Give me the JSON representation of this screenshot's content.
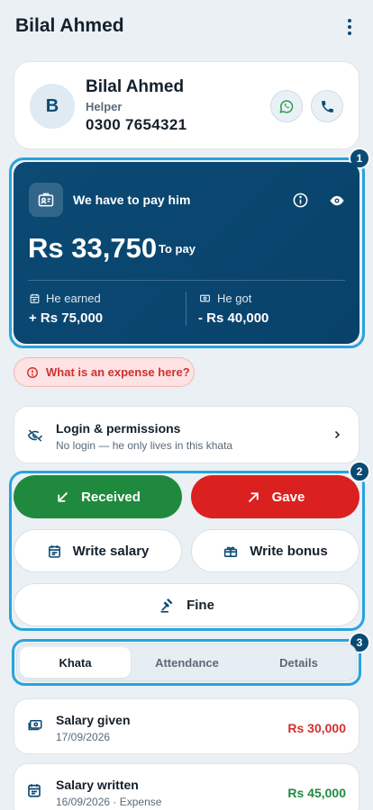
{
  "header": {
    "title": "Bilal Ahmed",
    "menu_icon": "kebab-menu-icon"
  },
  "profile": {
    "initial": "B",
    "name": "Bilal Ahmed",
    "role": "Helper",
    "phone": "0300 7654321",
    "whatsapp_icon": "whatsapp-icon",
    "call_icon": "phone-icon"
  },
  "highlights": {
    "one": "1",
    "two": "2",
    "three": "3"
  },
  "balance": {
    "label": "We have to pay him",
    "amount": "Rs 33,750",
    "status": "To pay",
    "earned_label": "He earned",
    "earned_value": "+ Rs 75,000",
    "got_label": "He got",
    "got_value": "- Rs 40,000"
  },
  "expense_chip": "What is an expense here?",
  "login": {
    "title": "Login & permissions",
    "subtitle": "No login — he only lives in this khata"
  },
  "actions": {
    "received": "Received",
    "gave": "Gave",
    "write_salary": "Write salary",
    "write_bonus": "Write bonus",
    "fine": "Fine"
  },
  "tabs": [
    "Khata",
    "Attendance",
    "Details"
  ],
  "transactions": [
    {
      "title": "Salary given",
      "date": "17/09/2026",
      "amount": "Rs 30,000"
    },
    {
      "title": "Salary written",
      "date": "16/09/2026 · Expense",
      "amount": "Rs 45,000"
    }
  ],
  "colors": {
    "primary": "#0b4a74",
    "highlight": "#29a3dc",
    "green": "#1f8a3d",
    "red": "#db2020",
    "background": "#eaf0f4"
  }
}
